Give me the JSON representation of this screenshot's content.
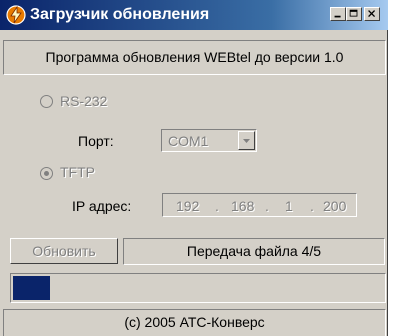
{
  "window": {
    "title": "Загрузчик обновления",
    "icon": "lightning-bolt-icon",
    "controls": [
      "minimize-icon",
      "maximize-icon",
      "close-icon"
    ]
  },
  "header": {
    "text": "Программа обновления WEBtel до версии 1.0"
  },
  "connection": {
    "rs232": {
      "label": "RS-232",
      "selected": false,
      "enabled": false
    },
    "port": {
      "label": "Порт:",
      "value": "COM1",
      "enabled": false
    },
    "tftp": {
      "label": "TFTP",
      "selected": true,
      "enabled": false
    },
    "ip": {
      "label": "IP адрес:",
      "octets": [
        "192",
        "168",
        "1",
        "200"
      ],
      "separator": "."
    }
  },
  "actions": {
    "update_label": "Обновить"
  },
  "status": {
    "text": "Передача файла 4/5"
  },
  "progress": {
    "fraction": 0.1
  },
  "footer": {
    "text": "(c) 2005 АТС-Конверс"
  },
  "colors": {
    "title_start": "#0a246a",
    "title_end": "#a6caf0",
    "face": "#d4d0c8",
    "progress": "#0a246a"
  }
}
